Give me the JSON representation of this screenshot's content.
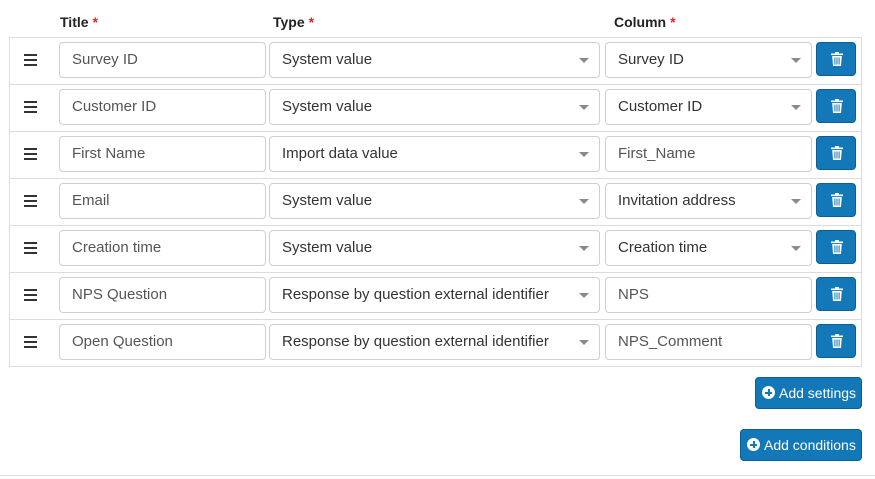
{
  "headers": {
    "title": "Title",
    "type": "Type",
    "column": "Column",
    "required_marker": "*"
  },
  "rows": [
    {
      "title": "Survey ID",
      "type": "System value",
      "column": "Survey ID",
      "column_kind": "select"
    },
    {
      "title": "Customer ID",
      "type": "System value",
      "column": "Customer ID",
      "column_kind": "select"
    },
    {
      "title": "First Name",
      "type": "Import data value",
      "column": "First_Name",
      "column_kind": "text"
    },
    {
      "title": "Email",
      "type": "System value",
      "column": "Invitation address",
      "column_kind": "select"
    },
    {
      "title": "Creation time",
      "type": "System value",
      "column": "Creation time",
      "column_kind": "select"
    },
    {
      "title": "NPS Question",
      "type": "Response by question external identifier",
      "column": "NPS",
      "column_kind": "text"
    },
    {
      "title": "Open Question",
      "type": "Response by question external identifier",
      "column": "NPS_Comment",
      "column_kind": "text"
    }
  ],
  "buttons": {
    "add_settings": "Add settings",
    "add_conditions": "Add conditions"
  },
  "icons": {
    "drag": "drag-handle-icon",
    "delete": "trash-icon",
    "dropdown": "chevron-down-icon",
    "add": "plus-circle-icon"
  },
  "colors": {
    "primary_button": "#1278b8",
    "required_asterisk": "#d9262c"
  }
}
